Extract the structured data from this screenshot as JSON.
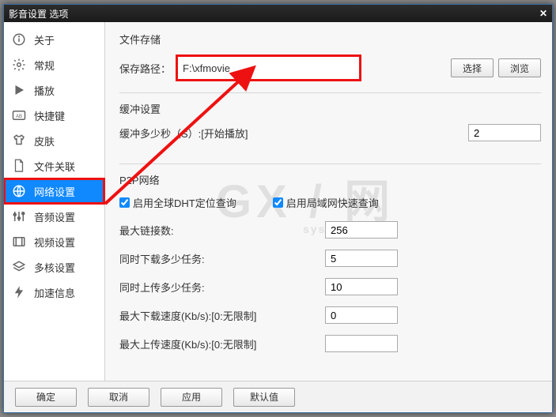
{
  "title": "影音设置 选项",
  "sidebar": {
    "items": [
      {
        "label": "关于"
      },
      {
        "label": "常规"
      },
      {
        "label": "播放"
      },
      {
        "label": "快捷键"
      },
      {
        "label": "皮肤"
      },
      {
        "label": "文件关联"
      },
      {
        "label": "网络设置"
      },
      {
        "label": "音频设置"
      },
      {
        "label": "视频设置"
      },
      {
        "label": "多核设置"
      },
      {
        "label": "加速信息"
      }
    ]
  },
  "storage": {
    "section": "文件存储",
    "path_label": "保存路径：",
    "path_value": "F:\\xfmovie",
    "choose_btn": "选择",
    "browse_btn": "浏览"
  },
  "buffer": {
    "section": "缓冲设置",
    "label": "缓冲多少秒（S）:[开始播放]",
    "value": "2"
  },
  "p2p": {
    "section": "P2P网络",
    "enable_dht": "启用全球DHT定位查询",
    "enable_lan": "启用局域网快速查询",
    "max_conn_label": "最大链接数:",
    "max_conn": "256",
    "down_tasks_label": "同时下载多少任务:",
    "down_tasks": "5",
    "up_tasks_label": "同时上传多少任务:",
    "up_tasks": "10",
    "max_down_label": "最大下载速度(Kb/s):[0:无限制]",
    "max_down": "0",
    "max_up_label": "最大上传速度(Kb/s):[0:无限制]",
    "max_up": ""
  },
  "footer": {
    "ok": "确定",
    "cancel": "取消",
    "apply": "应用",
    "defaults": "默认值"
  },
  "watermark": {
    "big": "GX / 网",
    "small": "system.com"
  }
}
